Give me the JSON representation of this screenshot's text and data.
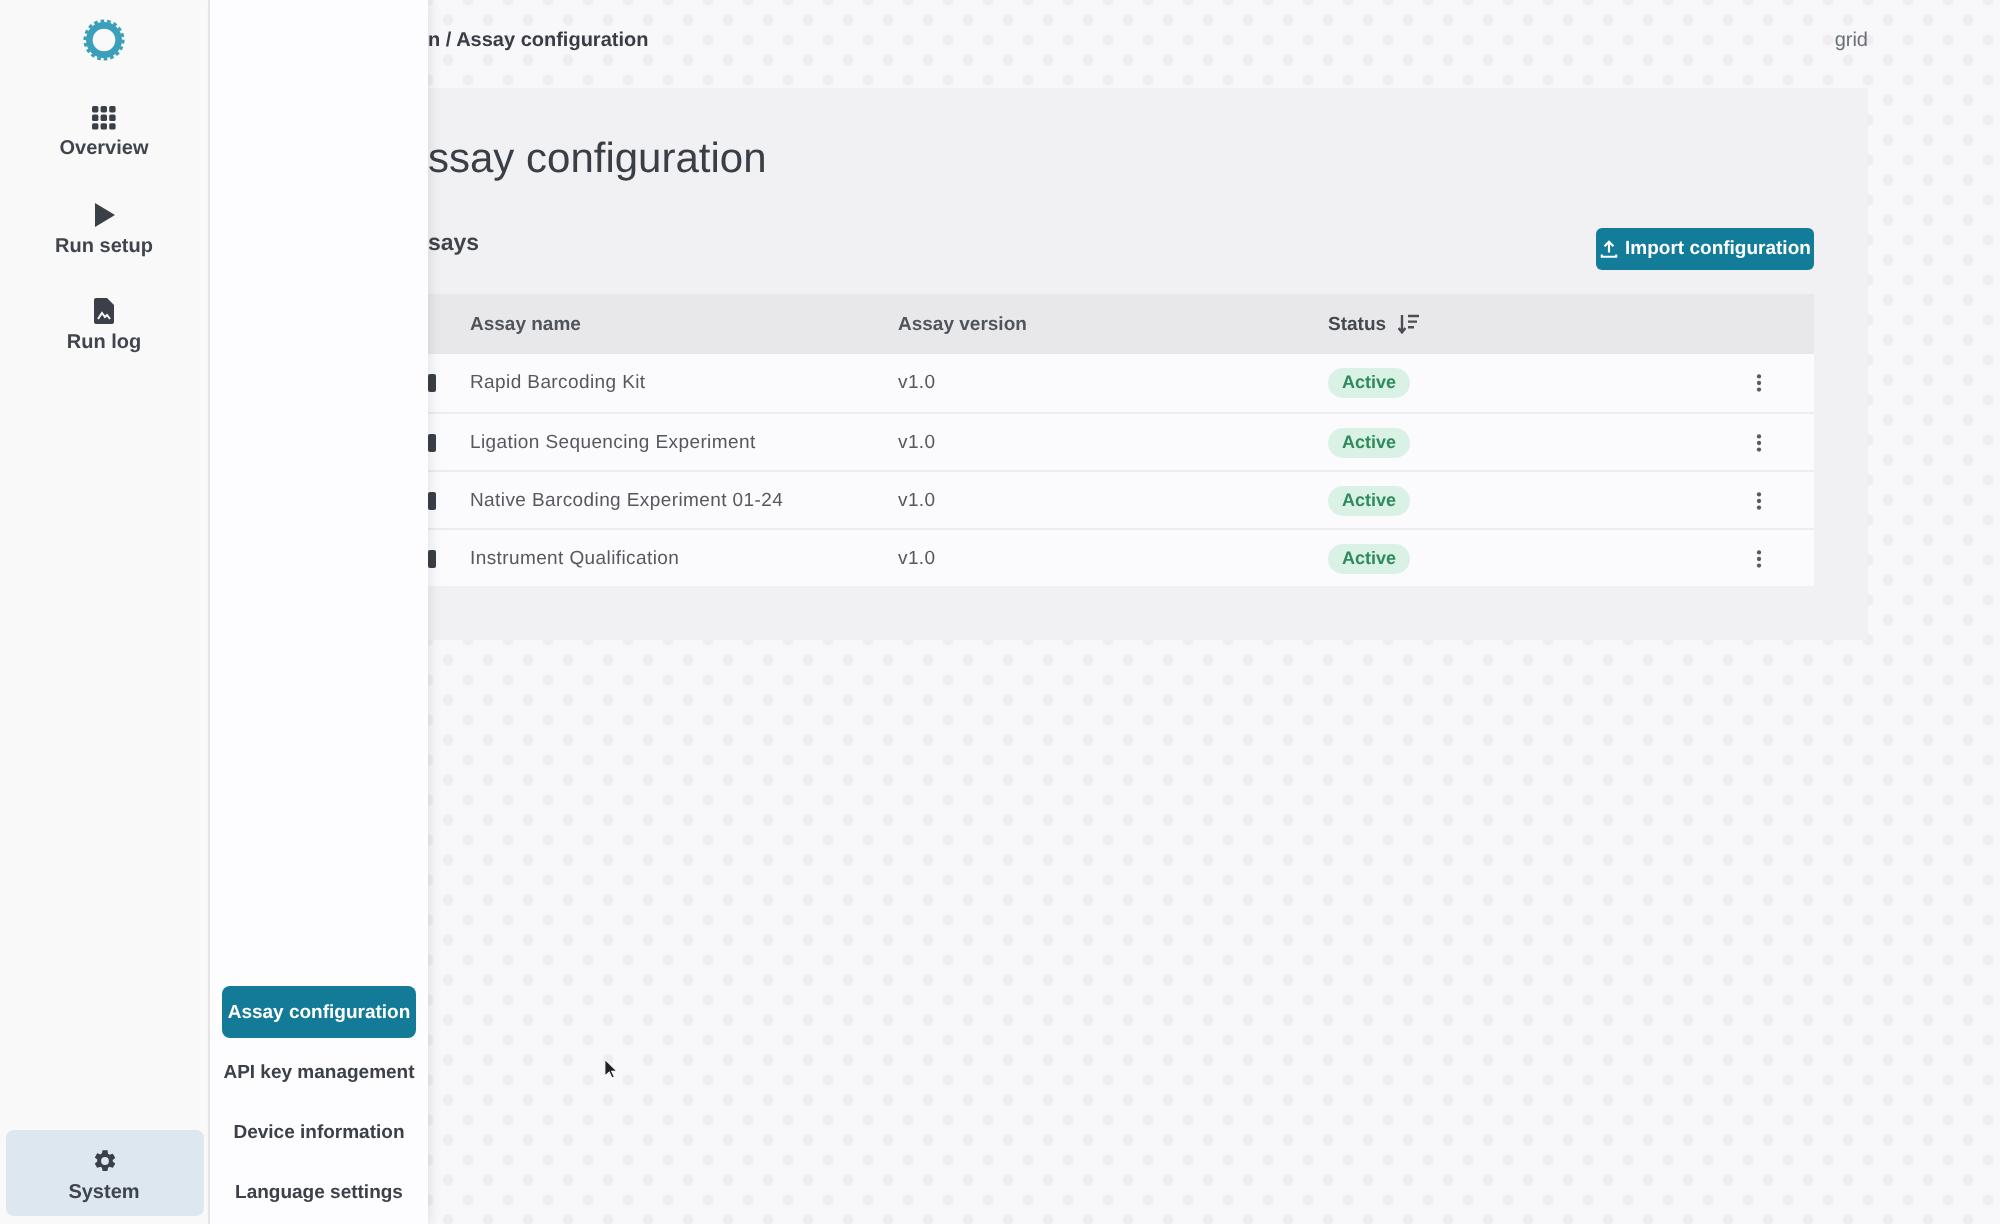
{
  "nav": {
    "items": [
      {
        "label": "Overview",
        "selected": false
      },
      {
        "label": "Run setup",
        "selected": false
      },
      {
        "label": "Run log",
        "selected": false
      }
    ],
    "system": {
      "label": "System",
      "selected": true
    }
  },
  "submenu": {
    "items": [
      {
        "label": "Assay configuration",
        "selected": true
      },
      {
        "label": "API key management",
        "selected": false
      },
      {
        "label": "Device information",
        "selected": false
      },
      {
        "label": "Language settings",
        "selected": false
      }
    ]
  },
  "top_bar": {
    "breadcrumb": "n / Assay configuration",
    "right_text": "grid"
  },
  "page": {
    "title": "ssay configuration",
    "section_title": "says",
    "import_button": "Import configuration",
    "table": {
      "columns": [
        {
          "label": "Assay name",
          "sorted": false
        },
        {
          "label": "Assay version",
          "sorted": false
        },
        {
          "label": "Status",
          "sorted": true
        }
      ],
      "rows": [
        {
          "name": "Rapid Barcoding Kit",
          "version": "v1.0",
          "status": "Active"
        },
        {
          "name": "Ligation Sequencing Experiment",
          "version": "v1.0",
          "status": "Active"
        },
        {
          "name": "Native Barcoding Experiment 01-24",
          "version": "v1.0",
          "status": "Active"
        },
        {
          "name": "Instrument Qualification",
          "version": "v1.0",
          "status": "Active"
        }
      ]
    }
  }
}
